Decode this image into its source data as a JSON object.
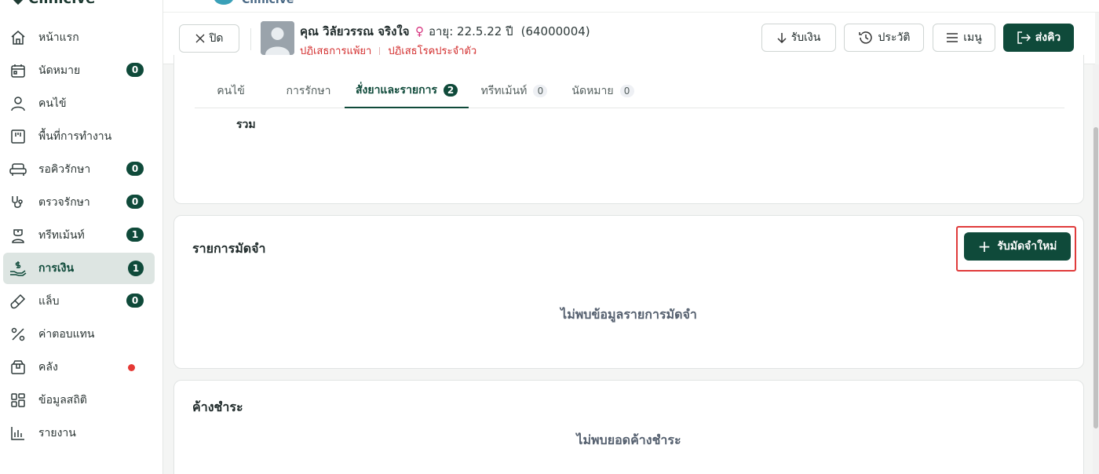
{
  "sidebar": {
    "brand": "Clinicive",
    "items": [
      {
        "label": "หน้าแรก",
        "icon": "home-icon"
      },
      {
        "label": "นัดหมาย",
        "icon": "calendar-icon",
        "badge": "0"
      },
      {
        "label": "คนไข้",
        "icon": "user-icon"
      },
      {
        "label": "พื้นที่การทำงาน",
        "icon": "workspace-icon"
      },
      {
        "label": "รอคิวรักษา",
        "icon": "sofa-icon",
        "badge": "0"
      },
      {
        "label": "ตรวจรักษา",
        "icon": "stethoscope-icon",
        "badge": "0"
      },
      {
        "label": "ทรีทเม้นท์",
        "icon": "nurse-icon",
        "badge": "1"
      },
      {
        "label": "การเงิน",
        "icon": "finance-icon",
        "badge": "1",
        "active": true
      },
      {
        "label": "แล็บ",
        "icon": "test-tube-icon",
        "badge": "0"
      },
      {
        "label": "ค่าตอบแทน",
        "icon": "percent-icon"
      },
      {
        "label": "คลัง",
        "icon": "box-icon",
        "dot": true
      },
      {
        "label": "ข้อมูลสถิติ",
        "icon": "grid-icon"
      },
      {
        "label": "รายงาน",
        "icon": "bar-chart-icon"
      }
    ]
  },
  "top": {
    "org_name": "Clinicive"
  },
  "patient": {
    "close_label": "ปิด",
    "name": "คุณ วิลัยวรรณ จริงใจ",
    "gender_symbol": "♀",
    "age": "อายุ: 22.5.22 ปี",
    "hn": "(64000004)",
    "allergy_drug": "ปฏิเสธการแพ้ยา",
    "allergy_disease": "ปฏิเสธโรคประจำตัว"
  },
  "actions": {
    "receive": "รับเงิน",
    "history": "ประวัติ",
    "menu": "เมนู",
    "send_queue": "ส่งคิว"
  },
  "tabs": [
    {
      "label": "คนไข้"
    },
    {
      "label": "การรักษา"
    },
    {
      "label": "สั่งยาและรายการ",
      "badge": "2",
      "active": true
    },
    {
      "label": "ทรีทเม้นท์",
      "badge": "0"
    },
    {
      "label": "นัดหมาย",
      "badge": "0"
    }
  ],
  "orders": {
    "total_label": "รวม"
  },
  "deposit": {
    "title": "รายการมัดจำ",
    "new_button": "รับมัดจำใหม่",
    "empty": "ไม่พบข้อมูลรายการมัดจำ"
  },
  "outstanding": {
    "title": "ค้างชำระ",
    "empty": "ไม่พบยอดค้างชำระ"
  },
  "colors": {
    "primary": "#0f4a3a",
    "danger": "#d32f2f",
    "highlight": "#e03b3b"
  }
}
